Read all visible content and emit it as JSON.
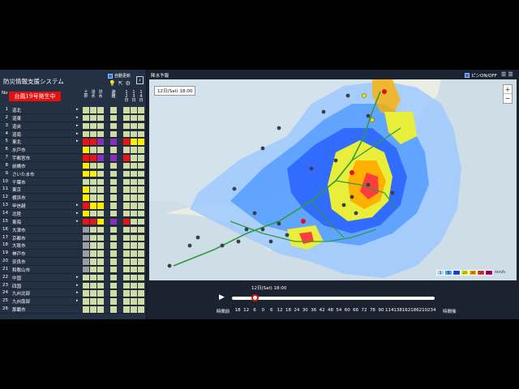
{
  "app": {
    "title": "防災情報支援システム",
    "auto_update_label": "自動更新",
    "collapse_icon": "‹",
    "typhoon_banner": "台風19号発生中",
    "no_header": "No",
    "columns": [
      "土砂",
      "浸水",
      "洪水",
      "避難",
      "12日",
      "13日",
      "14日"
    ]
  },
  "rows": [
    {
      "no": "1",
      "name": "道北",
      "arrow": true,
      "cells": [
        "",
        "",
        "",
        "",
        "",
        "",
        ""
      ]
    },
    {
      "no": "2",
      "name": "道東",
      "arrow": true,
      "cells": [
        "",
        "",
        "",
        "",
        "",
        "",
        ""
      ]
    },
    {
      "no": "3",
      "name": "道央",
      "arrow": true,
      "cells": [
        "",
        "",
        "",
        "",
        "",
        "",
        ""
      ]
    },
    {
      "no": "4",
      "name": "道南",
      "arrow": true,
      "cells": [
        "",
        "",
        "",
        "",
        "",
        "",
        ""
      ]
    },
    {
      "no": "5",
      "name": "東北",
      "arrow": true,
      "cells": [
        "r",
        "r",
        "p",
        "p",
        "r",
        "y",
        "y"
      ]
    },
    {
      "no": "6",
      "name": "水戸市",
      "arrow": false,
      "cells": [
        "y",
        "",
        "",
        "",
        "",
        "",
        ""
      ]
    },
    {
      "no": "7",
      "name": "宇都宮市",
      "arrow": false,
      "cells": [
        "r",
        "r",
        "p",
        "p",
        "r",
        "",
        ""
      ]
    },
    {
      "no": "8",
      "name": "前橋市",
      "arrow": false,
      "cells": [
        "y",
        "",
        "",
        "",
        "",
        "",
        ""
      ]
    },
    {
      "no": "9",
      "name": "さいたま市",
      "arrow": false,
      "cells": [
        "y",
        "y",
        "",
        "",
        "",
        "",
        ""
      ]
    },
    {
      "no": "10",
      "name": "千葉市",
      "arrow": false,
      "cells": [
        "",
        "",
        "",
        "",
        "",
        "",
        ""
      ]
    },
    {
      "no": "11",
      "name": "東京",
      "arrow": false,
      "cells": [
        "y",
        "",
        "",
        "",
        "",
        "",
        ""
      ]
    },
    {
      "no": "12",
      "name": "横浜市",
      "arrow": false,
      "cells": [
        "y",
        "",
        "",
        "",
        "",
        "",
        ""
      ]
    },
    {
      "no": "13",
      "name": "甲信越",
      "arrow": true,
      "cells": [
        "r",
        "y",
        "y",
        "",
        "",
        "",
        ""
      ]
    },
    {
      "no": "14",
      "name": "北陸",
      "arrow": true,
      "cells": [
        "y",
        "",
        "",
        "",
        "",
        "",
        ""
      ]
    },
    {
      "no": "15",
      "name": "東海",
      "arrow": true,
      "cells": [
        "r",
        "r",
        "y",
        "p",
        "r",
        "",
        ""
      ]
    },
    {
      "no": "16",
      "name": "大津市",
      "arrow": false,
      "cells": [
        "g",
        "",
        "",
        "",
        "",
        "",
        ""
      ]
    },
    {
      "no": "17",
      "name": "京都市",
      "arrow": false,
      "cells": [
        "g",
        "",
        "",
        "",
        "",
        "",
        ""
      ]
    },
    {
      "no": "18",
      "name": "大阪市",
      "arrow": false,
      "cells": [
        "g",
        "",
        "",
        "",
        "",
        "",
        ""
      ]
    },
    {
      "no": "19",
      "name": "神戸市",
      "arrow": false,
      "cells": [
        "g",
        "",
        "",
        "",
        "",
        "",
        ""
      ]
    },
    {
      "no": "20",
      "name": "奈良市",
      "arrow": false,
      "cells": [
        "g",
        "",
        "",
        "",
        "",
        "",
        ""
      ]
    },
    {
      "no": "21",
      "name": "和歌山市",
      "arrow": false,
      "cells": [
        "g",
        "",
        "",
        "",
        "",
        "",
        ""
      ]
    },
    {
      "no": "22",
      "name": "中国",
      "arrow": true,
      "cells": [
        "",
        "",
        "",
        "",
        "",
        "",
        ""
      ]
    },
    {
      "no": "23",
      "name": "四国",
      "arrow": true,
      "cells": [
        "",
        "",
        "",
        "",
        "",
        "",
        ""
      ]
    },
    {
      "no": "24",
      "name": "九州北部",
      "arrow": true,
      "cells": [
        "",
        "",
        "",
        "",
        "",
        "",
        ""
      ]
    },
    {
      "no": "25",
      "name": "九州南部",
      "arrow": true,
      "cells": [
        "",
        "",
        "",
        "",
        "",
        "",
        ""
      ]
    },
    {
      "no": "26",
      "name": "那覇市",
      "arrow": false,
      "cells": [
        "",
        "",
        "",
        "",
        "",
        "",
        ""
      ]
    }
  ],
  "map": {
    "title": "降水予報",
    "pin_toggle_label": "ピンON/OFF",
    "time_label": "12日(Sat) 18:00",
    "zoom_in": "+",
    "zoom_out": "−",
    "legend": [
      {
        "label": "1",
        "color": "#a8d8ff"
      },
      {
        "label": "5",
        "color": "#3fa0ff"
      },
      {
        "label": "10",
        "color": "#1f55ff"
      },
      {
        "label": "20",
        "color": "#f5f500"
      },
      {
        "label": "30",
        "color": "#ffb000"
      },
      {
        "label": "50",
        "color": "#ff3d3d"
      },
      {
        "label": "80",
        "color": "#c8007a"
      }
    ],
    "legend_unit": "mm/h"
  },
  "timeline": {
    "current": "12日(Sat) 18:00",
    "before_label": "時間前",
    "after_label": "時間後",
    "ticks": [
      "18",
      "12",
      "6",
      "0",
      "6",
      "12",
      "18",
      "24",
      "30",
      "36",
      "42",
      "48",
      "54",
      "60",
      "66",
      "72",
      "78",
      "90",
      "114",
      "138",
      "162",
      "186",
      "210",
      "234"
    ],
    "current_index": 3
  },
  "colors": {
    "red": "#ee1313",
    "purple": "#8a2fb5",
    "yellow": "#ffee00",
    "grey": "#9a9ea5",
    "empty": "#cfdca4",
    "banner": "#e41010",
    "accent": "#2d74d8"
  }
}
